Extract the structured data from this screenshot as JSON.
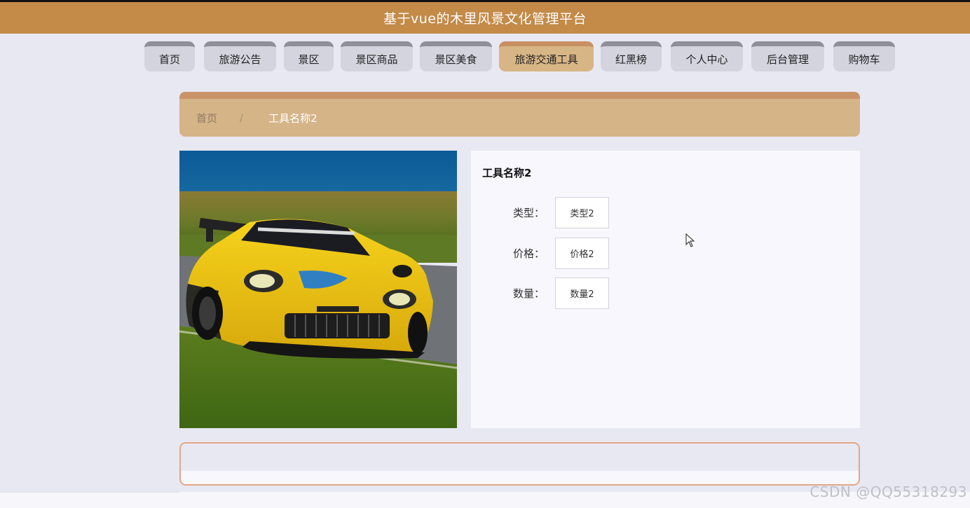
{
  "header": {
    "title": "基于vue的木里风景文化管理平台"
  },
  "nav": {
    "items": [
      {
        "label": "首页",
        "active": false
      },
      {
        "label": "旅游公告",
        "active": false
      },
      {
        "label": "景区",
        "active": false
      },
      {
        "label": "景区商品",
        "active": false
      },
      {
        "label": "景区美食",
        "active": false
      },
      {
        "label": "旅游交通工具",
        "active": true
      },
      {
        "label": "红黑榜",
        "active": false
      },
      {
        "label": "个人中心",
        "active": false
      },
      {
        "label": "后台管理",
        "active": false
      },
      {
        "label": "购物车",
        "active": false
      }
    ]
  },
  "breadcrumb": {
    "home": "首页",
    "separator": "/",
    "current": "工具名称2"
  },
  "detail": {
    "title": "工具名称2",
    "fields": [
      {
        "label": "类型：",
        "value": "类型2"
      },
      {
        "label": "价格：",
        "value": "价格2"
      },
      {
        "label": "数量：",
        "value": "数量2"
      }
    ]
  },
  "watermark": "CSDN @QQ55318293",
  "colors": {
    "header": "#c38a48",
    "nav_active": "#d8b585",
    "nav_default": "#d3d4de",
    "breadcrumb": "#d5b488",
    "panel_border": "#e3a684"
  }
}
